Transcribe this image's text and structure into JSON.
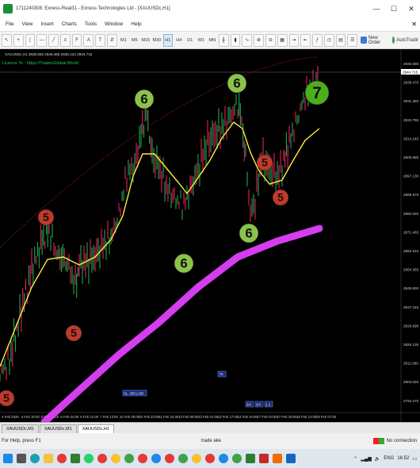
{
  "window": {
    "title": "1711240308: Exness-Real31 - Exness Technologies Ltd - [XAUUSDc,H1]"
  },
  "menu": [
    "File",
    "View",
    "Insert",
    "Charts",
    "Tools",
    "Window",
    "Help"
  ],
  "toolbar": {
    "periods": [
      "M1",
      "M5",
      "M15",
      "M30",
      "H1",
      "H4",
      "D1",
      "W1",
      "MN"
    ],
    "active_period": "H1",
    "new_order_label": "New Order",
    "autotrading_label": "AutoTradir"
  },
  "chart": {
    "info_line": "XAUUSDc,H1  2935.556 2946.466 2935.122 2944.715",
    "licence_text": "Licence To : https://TradesGlobal.World",
    "price_labels": [
      "2945.095",
      "2939.475",
      "2931.350",
      "2922.795",
      "2914.240",
      "2905.685",
      "2897.130",
      "2888.575",
      "2880.020",
      "2871.465",
      "2862.910",
      "2854.355",
      "2845.800",
      "2837.245",
      "2828.690",
      "2820.135",
      "2811.580",
      "2803.025",
      "2794.470"
    ],
    "current_price": "2944.715",
    "time_labels": [
      "4 Feb 2025",
      "4 Feb 18:00",
      "5 Feb 11:00",
      "6 Feb 04:00",
      "6 Feb 21:00",
      "7 Feb 13:00",
      "10 Feb 06:00",
      "10 Feb 23:00",
      "11 Feb 15:00",
      "12 Feb 08:00",
      "13 Feb 01:00",
      "13 Feb 17:00",
      "14 Feb 10:00",
      "17 Feb 03:00",
      "17 Feb 19:00",
      "18 Feb 14:00",
      "19 Feb 07:00"
    ],
    "wave_labels": [
      {
        "text": "5",
        "color": "#c0392b"
      },
      {
        "text": "5",
        "color": "#c0392b"
      },
      {
        "text": "5",
        "color": "#c0392b"
      },
      {
        "text": "6",
        "color": "#8bc34a"
      },
      {
        "text": "6",
        "color": "#8bc34a"
      },
      {
        "text": "6",
        "color": "#8bc34a"
      },
      {
        "text": "6",
        "color": "#8bc34a"
      },
      {
        "text": "5",
        "color": "#c0392b"
      },
      {
        "text": "5",
        "color": "#c0392b"
      },
      {
        "text": "7",
        "color": "#4caf1a"
      }
    ],
    "small_labels": [
      "SL: 2801.000",
      "TR",
      "3/4",
      "3/4",
      "2.3"
    ]
  },
  "tabs": [
    "XAUUSDc,M1",
    "XAUUSDc,M1",
    "XAUUSDc,H1"
  ],
  "active_tab": "XAUUSDc,H1",
  "status": {
    "help": "For Help, press F1",
    "profile": "trade ake",
    "connection": "No connection"
  },
  "taskbar": {
    "lang": "ENG",
    "time": "16:52"
  },
  "colors": {
    "chart_bg": "#000000",
    "ma_yellow": "#ffeb3b",
    "ma_magenta": "#e040fb",
    "candle_green": "#1fa84a",
    "candle_pink": "#e91e63",
    "dots_red": "#b71c1c"
  }
}
